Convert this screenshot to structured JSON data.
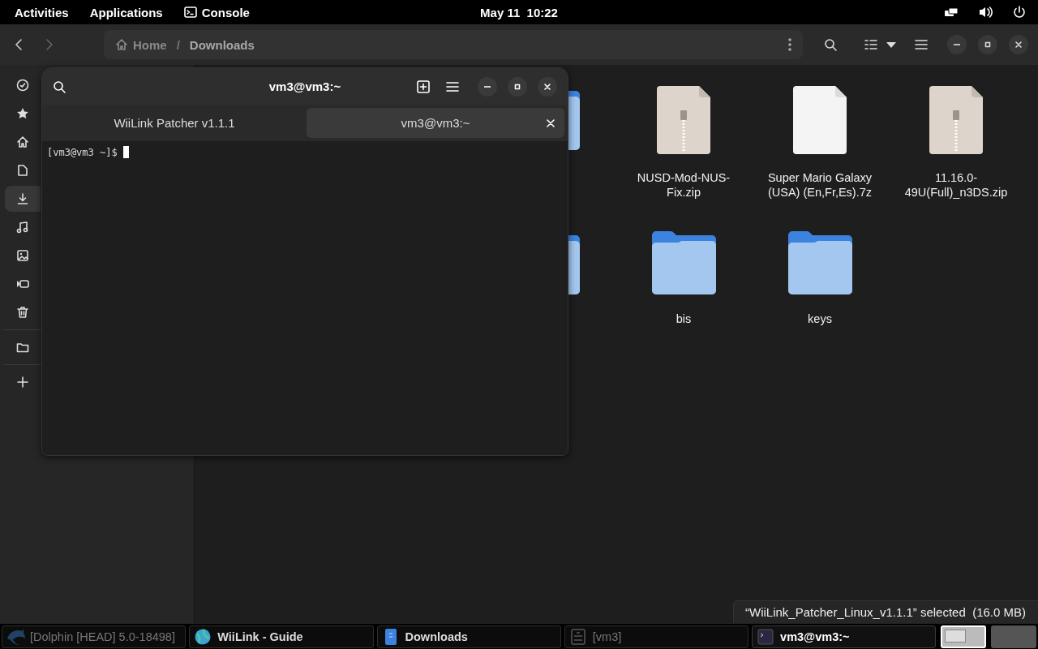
{
  "top_bar": {
    "activities": "Activities",
    "applications": "Applications",
    "app_menu": "Console",
    "clock": "May 11  10:22"
  },
  "files_window": {
    "path": [
      {
        "label": "Home",
        "selected": false
      },
      {
        "label": "Downloads",
        "selected": true
      }
    ],
    "sidebar": {
      "sections": [
        {
          "items": [
            {
              "selected": false
            },
            {
              "selected": false
            },
            {
              "selected": false
            },
            {
              "selected": false
            },
            {
              "selected": true
            },
            {
              "selected": false
            },
            {
              "selected": false
            },
            {
              "selected": false
            },
            {
              "selected": false
            }
          ]
        },
        {
          "items": [
            {
              "selected": false
            }
          ]
        },
        {
          "items": [
            {
              "selected": false
            }
          ]
        }
      ]
    },
    "path_separator": "/",
    "rows": [
      [
        {
          "kind": "folder"
        },
        {
          "kind": "archive",
          "name": "NUSD-Mod-NUS-Fix.zip"
        },
        {
          "kind": "file",
          "name": "Super Mario Galaxy (USA) (En,Fr,Es).7z"
        },
        {
          "kind": "archive",
          "name": "11.16.0-49U(Full)_n3DS.zip"
        }
      ],
      [
        {
          "kind": "folder"
        },
        {
          "kind": "folder",
          "name": "bis"
        },
        {
          "kind": "folder",
          "name": "keys"
        }
      ]
    ],
    "status": "“WiiLink_Patcher_Linux_v1.1.1” selected  (16.0 MB)"
  },
  "terminal": {
    "title": "vm3@vm3:~",
    "tabs": [
      {
        "label": "WiiLink Patcher v1.1.1",
        "selected": false
      },
      {
        "label": "vm3@vm3:~",
        "selected": true
      }
    ],
    "prompt": "[vm3@vm3 ~]$"
  },
  "taskbar": {
    "items": [
      {
        "label": "[Dolphin [HEAD] 5.0-18498]",
        "minimized": true,
        "selected": false
      },
      {
        "label": "WiiLink - Guide",
        "minimized": false,
        "selected": false
      },
      {
        "label": "Downloads",
        "minimized": false,
        "selected": false
      },
      {
        "label": "[vm3]",
        "minimized": true,
        "selected": false
      },
      {
        "label": "vm3@vm3:~",
        "minimized": false,
        "selected": true
      }
    ],
    "workspaces": [
      {
        "selected": true
      },
      {
        "selected": false
      }
    ]
  }
}
